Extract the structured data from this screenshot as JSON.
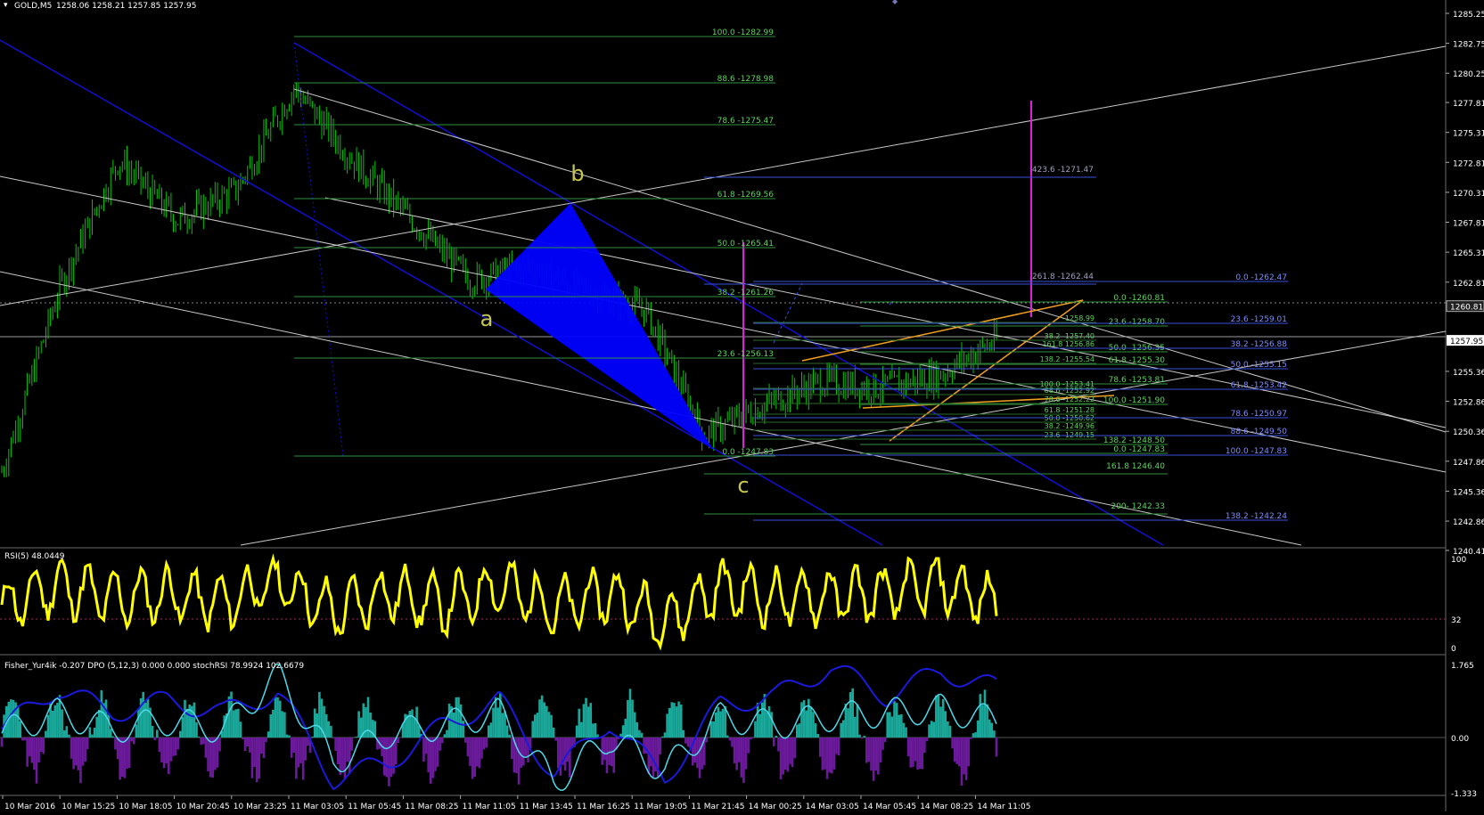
{
  "window": {
    "symbol_header": "GOLD,M5",
    "ohlc": "1258.06 1258.21 1257.85 1257.95"
  },
  "colors": {
    "background": "#000000",
    "candle": "#00c800",
    "fib_line": "#2f8f3a",
    "fib_text": "#5fd35f",
    "fib2_line": "#3b4fd9",
    "fib2_text": "#7f8cff",
    "channel_blue": "#1010d0",
    "channel_white": "#c8c8c8",
    "magenta": "#e020e0",
    "orange": "#f0a020",
    "wave_label": "#c8c850",
    "rsi_line": "#ffff00",
    "hist_pos": "#1aa89a",
    "hist_neg": "#6a1a9a",
    "fisher_line": "#1a1adc",
    "stoch_line": "#4fd8e8",
    "axis_text": "#ffffff",
    "separator": "#6a6a6a"
  },
  "price_axis": {
    "labels": [
      "1285.25",
      "1282.75",
      "1280.25",
      "1277.81",
      "1275.31",
      "1272.81",
      "1270.31",
      "1267.81",
      "1265.31",
      "1262.81",
      "1260.81",
      "1257.95",
      "1255.36",
      "1252.86",
      "1250.36",
      "1247.86",
      "1245.36",
      "1242.86",
      "1240.41"
    ],
    "values": [
      1285.25,
      1282.75,
      1280.25,
      1277.81,
      1275.31,
      1272.81,
      1270.31,
      1267.81,
      1265.31,
      1262.81,
      1260.81,
      1257.95,
      1255.36,
      1252.86,
      1250.36,
      1247.86,
      1245.36,
      1242.86,
      1240.41
    ],
    "current_price": "1257.95",
    "crosshair_price": "1260.81"
  },
  "time_axis": {
    "labels": [
      "10 Mar 2016",
      "10 Mar 15:25",
      "10 Mar 18:05",
      "10 Mar 20:45",
      "10 Mar 23:25",
      "11 Mar 03:05",
      "11 Mar 05:45",
      "11 Mar 08:25",
      "11 Mar 11:05",
      "11 Mar 13:45",
      "11 Mar 16:25",
      "11 Mar 19:05",
      "11 Mar 21:45",
      "14 Mar 00:25",
      "14 Mar 03:05",
      "14 Mar 05:45",
      "14 Mar 08:25",
      "14 Mar 11:05"
    ]
  },
  "wave_labels": [
    "a",
    "b",
    "c"
  ],
  "fib_levels": {
    "main": [
      "100.0 -1282.99",
      "88.6 -1278.98",
      "78.6 -1275.47",
      "61.8 -1269.56",
      "50.0 -1265.41",
      "38.2 -1261.26",
      "23.6 -1256.13",
      "0.0 -1247.83"
    ],
    "extension": [
      "423.6 -1271.47",
      "261.8 -1262.44",
      "161.8 1246.40",
      "200- 1242.33"
    ],
    "right_green": [
      "0.0 -1260.81",
      "23.6 -1258.70",
      "50.0 -1256.35",
      "61.8 -1255.30",
      "78.6 -1253.81",
      "100.0 -1251.90",
      "138.2 -1248.50",
      "0.0 -1247.83"
    ],
    "mid_green": [
      "-1258.99",
      "38.2 -1257.40",
      "161.8 1256.86",
      "138.2 -1255.54",
      "100.0 -1253.41",
      "88.6 -1252.92",
      "78.6 -1252.22",
      "61.8 -1251.28",
      "50.0 -1250.62",
      "38.2 -1249.96",
      "23.6 -1249.15"
    ],
    "blue": [
      "0.0 -1262.47",
      "23.6 -1259.01",
      "38.2 -1256.88",
      "50.0 -1255.15",
      "61.8 -1253.42",
      "78.6 -1250.97",
      "88.6 -1249.50",
      "100.0 -1247.83",
      "138.2 -1242.24"
    ]
  },
  "chart_data": [
    {
      "type": "candlestick",
      "title": "GOLD,M5",
      "xlabel": "",
      "ylabel": "",
      "ylim": [
        1240.41,
        1285.25
      ],
      "x": [
        "10 Mar 2016",
        "10 Mar 15:25",
        "10 Mar 18:05",
        "10 Mar 20:45",
        "10 Mar 23:25",
        "11 Mar 03:05",
        "11 Mar 05:45",
        "11 Mar 08:25",
        "11 Mar 11:05",
        "11 Mar 13:45",
        "11 Mar 16:25",
        "11 Mar 19:05",
        "11 Mar 21:45",
        "14 Mar 00:25",
        "14 Mar 03:05",
        "14 Mar 05:45",
        "14 Mar 08:25",
        "14 Mar 11:05"
      ],
      "series": [
        {
          "name": "",
          "values": [
            1247.0,
            1262.5,
            1273.0,
            1268.0,
            1270.5,
            1279.0,
            1273.0,
            1268.0,
            1263.0,
            1264.0,
            1262.0,
            1260.5,
            1250.0,
            1252.5,
            1254.5,
            1254.0,
            1255.0,
            1258.0
          ]
        }
      ]
    },
    {
      "type": "line",
      "title": "RSI(5) 48.0449",
      "ylim": [
        0,
        100
      ],
      "tick_labels": [
        "100",
        "32",
        "0"
      ],
      "series": [
        {
          "name": "RSI(5)",
          "values": [
            45,
            70,
            55,
            60,
            50,
            75,
            40,
            62,
            48,
            70,
            45,
            60,
            30,
            68,
            55,
            58,
            60,
            72,
            48
          ]
        }
      ]
    },
    {
      "type": "line",
      "title": "Fisher_Yur4ik -0.207  DPO (5,12,3) 0.000 0.000  stochRSI 78.9924 102.6679",
      "ylim": [
        -1.333,
        1.765
      ],
      "tick_labels": [
        "1.765",
        "0.00",
        "-1.333"
      ],
      "series": [
        {
          "name": "Fisher_Yur4ik",
          "values": [
            0.2,
            1.2,
            0.6,
            0.9,
            0.6,
            1.1,
            -1.0,
            -0.6,
            0.3,
            0.9,
            -0.9,
            0.4,
            -1.0,
            0.8,
            1.0,
            1.7,
            1.0,
            1.6,
            1.2
          ]
        },
        {
          "name": "stochRSI",
          "values": [
            0.1,
            0.6,
            0.2,
            0.4,
            0.2,
            1.5,
            -0.6,
            0.1,
            0.3,
            0.6,
            -1.1,
            0.0,
            -0.8,
            0.5,
            0.3,
            0.5,
            0.6,
            0.7,
            0.4
          ]
        }
      ]
    }
  ],
  "indicators": {
    "rsi_title": "RSI(5) 48.0449",
    "rsi_levels": [
      "100",
      "32",
      "0"
    ],
    "osc_title": "Fisher_Yur4ik -0.207  DPO (5,12,3) 0.000 0.000  stochRSI 78.9924 102.6679",
    "osc_levels": [
      "1.765",
      "0.00",
      "-1.333"
    ]
  }
}
